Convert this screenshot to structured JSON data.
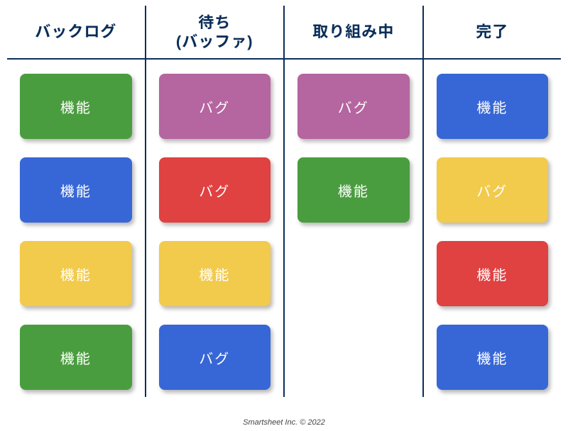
{
  "palette": {
    "green": "#4a9d3f",
    "blue": "#3767d6",
    "yellow": "#f2ca4c",
    "red": "#e04141",
    "purple": "#b565a0"
  },
  "columns": [
    {
      "id": "backlog",
      "title": "バックログ",
      "cards": [
        {
          "label": "機能",
          "color": "green"
        },
        {
          "label": "機能",
          "color": "blue"
        },
        {
          "label": "機能",
          "color": "yellow"
        },
        {
          "label": "機能",
          "color": "green"
        }
      ]
    },
    {
      "id": "buffer",
      "title": "待ち\n(バッファ)",
      "cards": [
        {
          "label": "バグ",
          "color": "purple"
        },
        {
          "label": "バグ",
          "color": "red"
        },
        {
          "label": "機能",
          "color": "yellow"
        },
        {
          "label": "バグ",
          "color": "blue"
        }
      ]
    },
    {
      "id": "in-progress",
      "title": "取り組み中",
      "cards": [
        {
          "label": "バグ",
          "color": "purple"
        },
        {
          "label": "機能",
          "color": "green"
        }
      ]
    },
    {
      "id": "done",
      "title": "完了",
      "cards": [
        {
          "label": "機能",
          "color": "blue"
        },
        {
          "label": "バグ",
          "color": "yellow"
        },
        {
          "label": "機能",
          "color": "red"
        },
        {
          "label": "機能",
          "color": "blue"
        }
      ]
    }
  ],
  "footer": "Smartsheet Inc. © 2022"
}
